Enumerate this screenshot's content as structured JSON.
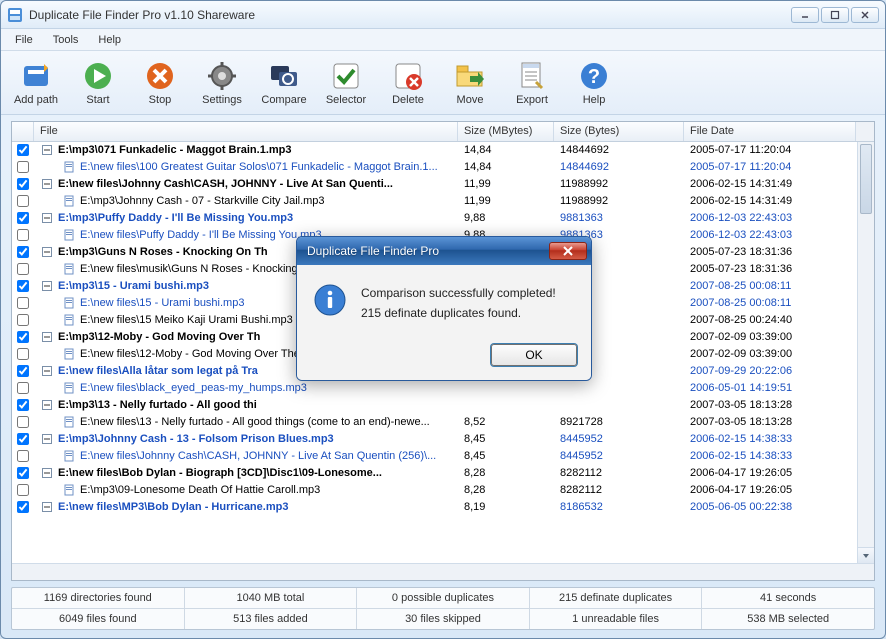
{
  "window": {
    "title": "Duplicate File Finder Pro v1.10 Shareware"
  },
  "menu": {
    "file": "File",
    "tools": "Tools",
    "help": "Help"
  },
  "toolbar": {
    "addpath": "Add path",
    "start": "Start",
    "stop": "Stop",
    "settings": "Settings",
    "compare": "Compare",
    "selector": "Selector",
    "delete": "Delete",
    "move": "Move",
    "export": "Export",
    "help": "Help"
  },
  "columns": {
    "file": "File",
    "sizem": "Size (MBytes)",
    "sizeb": "Size (Bytes)",
    "date": "File Date"
  },
  "rows": [
    {
      "checked": true,
      "group": true,
      "link": false,
      "indent": 0,
      "minus": true,
      "file": "E:\\mp3\\071 Funkadelic - Maggot Brain.1.mp3",
      "sizem": "14,84",
      "sizeb": "14844692",
      "date": "2005-07-17 11:20:04"
    },
    {
      "checked": false,
      "group": false,
      "link": true,
      "indent": 1,
      "minus": false,
      "file": "E:\\new files\\100 Greatest Guitar Solos\\071 Funkadelic - Maggot Brain.1...",
      "sizem": "14,84",
      "sizeb": "14844692",
      "date": "2005-07-17 11:20:04"
    },
    {
      "checked": true,
      "group": true,
      "link": false,
      "indent": 0,
      "minus": true,
      "file": "E:\\new files\\Johnny Cash\\CASH, JOHNNY - Live At San Quenti...",
      "sizem": "11,99",
      "sizeb": "11988992",
      "date": "2006-02-15 14:31:49"
    },
    {
      "checked": false,
      "group": false,
      "link": false,
      "indent": 1,
      "minus": false,
      "file": "E:\\mp3\\Johnny Cash - 07 - Starkville City Jail.mp3",
      "sizem": "11,99",
      "sizeb": "11988992",
      "date": "2006-02-15 14:31:49"
    },
    {
      "checked": true,
      "group": true,
      "link": true,
      "indent": 0,
      "minus": true,
      "file": "E:\\mp3\\Puffy Daddy - I'll Be Missing You.mp3",
      "sizem": "9,88",
      "sizeb": "9881363",
      "date": "2006-12-03 22:43:03"
    },
    {
      "checked": false,
      "group": false,
      "link": true,
      "indent": 1,
      "minus": false,
      "file": "E:\\new files\\Puffy Daddy - I'll Be Missing You.mp3",
      "sizem": "9,88",
      "sizeb": "9881363",
      "date": "2006-12-03 22:43:03"
    },
    {
      "checked": true,
      "group": true,
      "link": false,
      "indent": 0,
      "minus": true,
      "file": "E:\\mp3\\Guns N Roses - Knocking On Th",
      "sizem": "",
      "sizeb": "",
      "date": "2005-07-23 18:31:36"
    },
    {
      "checked": false,
      "group": false,
      "link": false,
      "indent": 1,
      "minus": false,
      "file": "E:\\new files\\musik\\Guns N Roses - Knocking O",
      "sizem": "",
      "sizeb": "",
      "date": "2005-07-23 18:31:36"
    },
    {
      "checked": true,
      "group": true,
      "link": true,
      "indent": 0,
      "minus": true,
      "file": "E:\\mp3\\15 - Urami bushi.mp3",
      "sizem": "",
      "sizeb": "",
      "date": "2007-08-25 00:08:11"
    },
    {
      "checked": false,
      "group": false,
      "link": true,
      "indent": 1,
      "minus": false,
      "file": "E:\\new files\\15 - Urami bushi.mp3",
      "sizem": "",
      "sizeb": "",
      "date": "2007-08-25 00:08:11"
    },
    {
      "checked": false,
      "group": false,
      "link": false,
      "indent": 1,
      "minus": false,
      "file": "E:\\new files\\15 Meiko Kaji Urami Bushi.mp3",
      "sizem": "",
      "sizeb": "",
      "date": "2007-08-25 00:24:40"
    },
    {
      "checked": true,
      "group": true,
      "link": false,
      "indent": 0,
      "minus": true,
      "file": "E:\\mp3\\12-Moby - God Moving Over Th",
      "sizem": "",
      "sizeb": "",
      "date": "2007-02-09 03:39:00"
    },
    {
      "checked": false,
      "group": false,
      "link": false,
      "indent": 1,
      "minus": false,
      "file": "E:\\new files\\12-Moby - God Moving Over The F",
      "sizem": "",
      "sizeb": "",
      "date": "2007-02-09 03:39:00"
    },
    {
      "checked": true,
      "group": true,
      "link": true,
      "indent": 0,
      "minus": true,
      "file": "E:\\new files\\Alla låtar som legat på Tra",
      "sizem": "",
      "sizeb": "",
      "date": "2007-09-29 20:22:06"
    },
    {
      "checked": false,
      "group": false,
      "link": true,
      "indent": 1,
      "minus": false,
      "file": "E:\\new files\\black_eyed_peas-my_humps.mp3",
      "sizem": "",
      "sizeb": "",
      "date": "2006-05-01 14:19:51"
    },
    {
      "checked": true,
      "group": true,
      "link": false,
      "indent": 0,
      "minus": true,
      "file": "E:\\mp3\\13 - Nelly furtado - All good thi",
      "sizem": "",
      "sizeb": "",
      "date": "2007-03-05 18:13:28"
    },
    {
      "checked": false,
      "group": false,
      "link": false,
      "indent": 1,
      "minus": false,
      "file": "E:\\new files\\13 - Nelly furtado - All good things (come to an end)-newe...",
      "sizem": "8,52",
      "sizeb": "8921728",
      "date": "2007-03-05 18:13:28"
    },
    {
      "checked": true,
      "group": true,
      "link": true,
      "indent": 0,
      "minus": true,
      "file": "E:\\mp3\\Johnny Cash - 13 - Folsom Prison Blues.mp3",
      "sizem": "8,45",
      "sizeb": "8445952",
      "date": "2006-02-15 14:38:33"
    },
    {
      "checked": false,
      "group": false,
      "link": true,
      "indent": 1,
      "minus": false,
      "file": "E:\\new files\\Johnny Cash\\CASH, JOHNNY - Live At San Quentin  (256)\\...",
      "sizem": "8,45",
      "sizeb": "8445952",
      "date": "2006-02-15 14:38:33"
    },
    {
      "checked": true,
      "group": true,
      "link": false,
      "indent": 0,
      "minus": true,
      "file": "E:\\new files\\Bob Dylan - Biograph [3CD]\\Disc1\\09-Lonesome...",
      "sizem": "8,28",
      "sizeb": "8282112",
      "date": "2006-04-17 19:26:05"
    },
    {
      "checked": false,
      "group": false,
      "link": false,
      "indent": 1,
      "minus": false,
      "file": "E:\\mp3\\09-Lonesome Death Of Hattie Caroll.mp3",
      "sizem": "8,28",
      "sizeb": "8282112",
      "date": "2006-04-17 19:26:05"
    },
    {
      "checked": true,
      "group": true,
      "link": true,
      "indent": 0,
      "minus": true,
      "file": "E:\\new files\\MP3\\Bob Dylan - Hurricane.mp3",
      "sizem": "8,19",
      "sizeb": "8186532",
      "date": "2005-06-05 00:22:38"
    }
  ],
  "status": {
    "r1c1": "1169 directories found",
    "r1c2": "1040 MB total",
    "r1c3": "0 possible duplicates",
    "r1c4": "215 definate duplicates",
    "r1c5": "41 seconds",
    "r2c1": "6049 files found",
    "r2c2": "513 files added",
    "r2c3": "30 files skipped",
    "r2c4": "1 unreadable files",
    "r2c5": "538 MB selected"
  },
  "dialog": {
    "title": "Duplicate File Finder Pro",
    "line1": "Comparison successfully completed!",
    "line2": "215 definate duplicates found.",
    "ok": "OK"
  }
}
